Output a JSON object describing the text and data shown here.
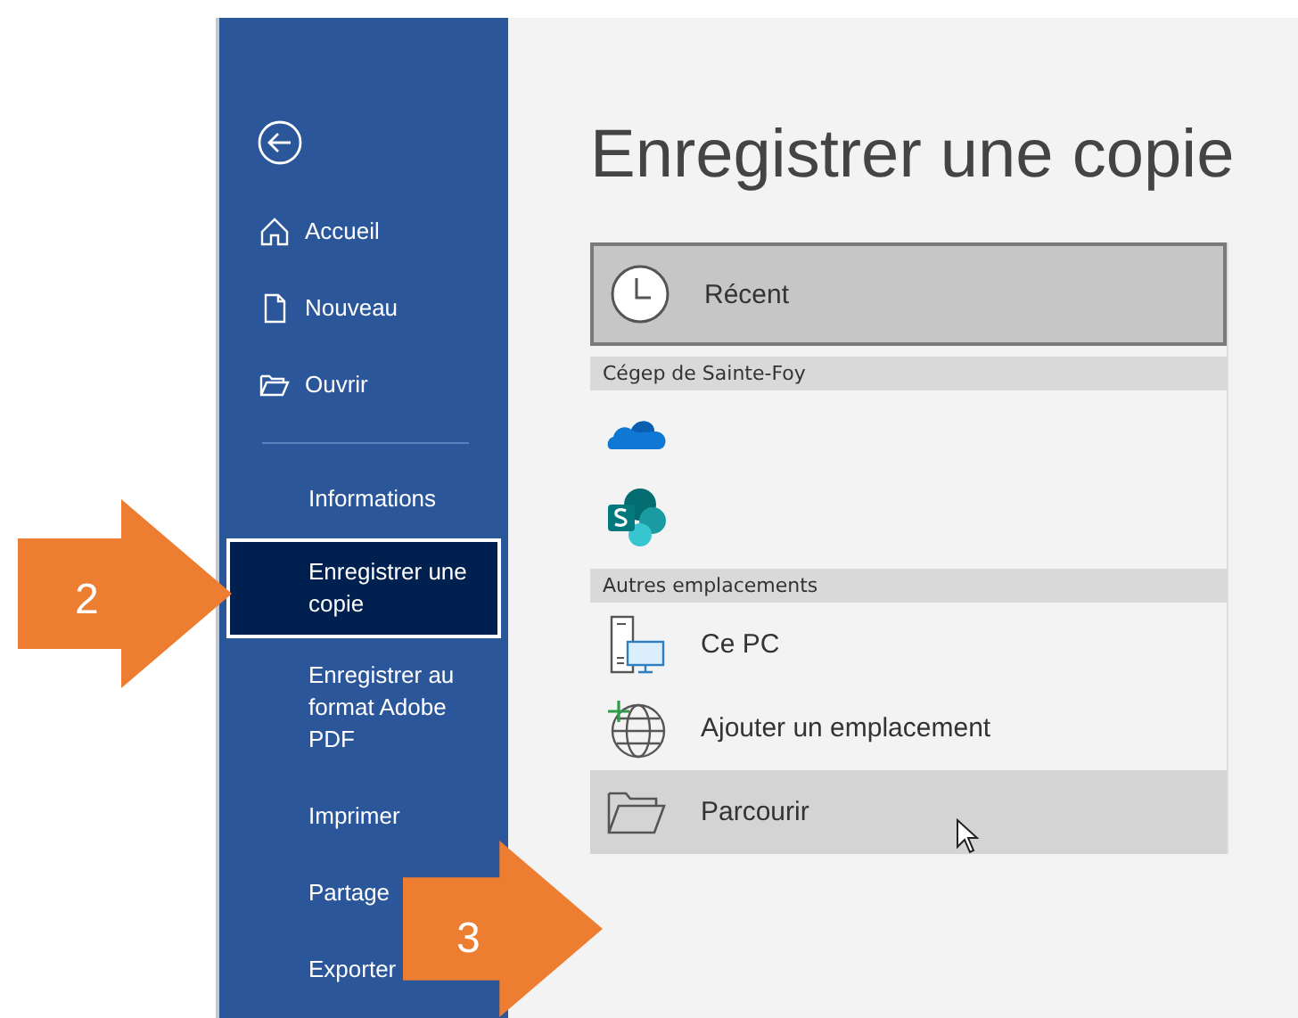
{
  "sidebar": {
    "items": [
      {
        "label": "Accueil",
        "selected": false
      },
      {
        "label": "Nouveau",
        "selected": false
      },
      {
        "label": "Ouvrir",
        "selected": false
      },
      {
        "kind": "divider"
      },
      {
        "label": "Informations",
        "selected": false
      },
      {
        "label": "Enregistrer une copie",
        "selected": true
      },
      {
        "label": "Enregistrer au format Adobe PDF",
        "selected": false
      },
      {
        "label": "Imprimer",
        "selected": false
      },
      {
        "label": "Partage",
        "selected": false
      },
      {
        "label": "Exporter",
        "selected": false
      }
    ]
  },
  "main": {
    "title": "Enregistrer une copie",
    "locations": [
      {
        "kind": "item",
        "label": "Récent",
        "selected": true,
        "hovered": false
      },
      {
        "kind": "header",
        "label": "Cégep de Sainte-Foy"
      },
      {
        "kind": "item",
        "selected": false,
        "hovered": false
      },
      {
        "kind": "item",
        "selected": false,
        "hovered": false
      },
      {
        "kind": "header",
        "label": "Autres emplacements"
      },
      {
        "kind": "item",
        "label": "Ce PC",
        "selected": false,
        "hovered": false
      },
      {
        "kind": "item",
        "label": "Ajouter un emplacement",
        "selected": false,
        "hovered": false
      },
      {
        "kind": "item",
        "label": "Parcourir",
        "selected": false,
        "hovered": true
      }
    ]
  },
  "callouts": [
    {
      "label": "2"
    },
    {
      "label": "3"
    }
  ]
}
